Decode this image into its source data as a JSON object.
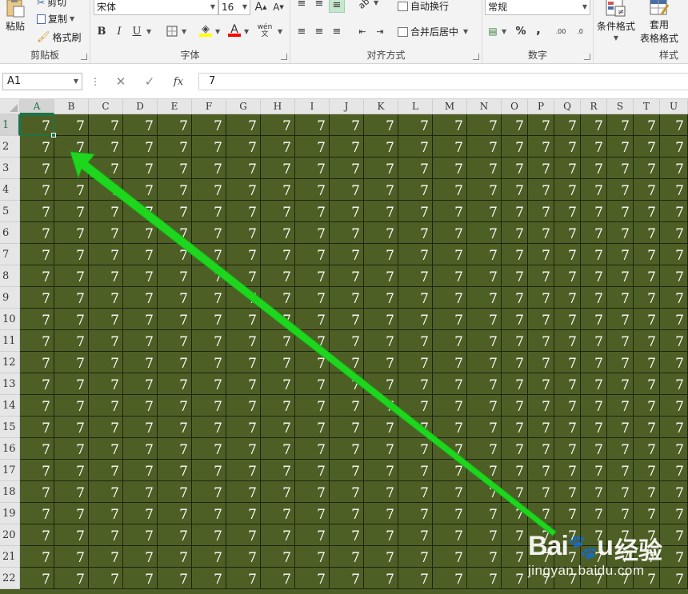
{
  "ribbon": {
    "clipboard": {
      "label": "剪贴板",
      "paste": "粘贴",
      "cut": "剪切",
      "copy": "复制",
      "format_painter": "格式刷"
    },
    "font": {
      "label": "字体",
      "font_name": "宋体",
      "font_size": "16",
      "grow_label": "A",
      "shrink_label": "A",
      "bold": "B",
      "italic": "I",
      "underline": "U",
      "font_color_letter": "A",
      "phonetic": "wén"
    },
    "alignment": {
      "label": "对齐方式",
      "wrap_text": "自动换行",
      "merge_center": "合并后居中"
    },
    "number": {
      "label": "数字",
      "format": "常规",
      "percent": "%",
      "comma": ",",
      "inc_decimal": ".00",
      "dec_decimal": ".0"
    },
    "styles": {
      "label": "样式",
      "conditional_format": "条件格式",
      "table_format_line1": "套用",
      "table_format_line2": "表格格式"
    },
    "accent_color": "#217346"
  },
  "formula_bar": {
    "name_box": "A1",
    "fx_symbol": "fx",
    "content": "7"
  },
  "sheet": {
    "columns": [
      "A",
      "B",
      "C",
      "D",
      "E",
      "F",
      "G",
      "H",
      "I",
      "J",
      "K",
      "L",
      "M",
      "N",
      "O",
      "P",
      "Q",
      "R",
      "S",
      "T",
      "U"
    ],
    "rows": [
      "1",
      "2",
      "3",
      "4",
      "5",
      "6",
      "7",
      "8",
      "9",
      "10",
      "11",
      "12",
      "13",
      "14",
      "15",
      "16",
      "17",
      "18",
      "19",
      "20",
      "21",
      "22"
    ],
    "cell_value": "7",
    "active_cell": "A1",
    "cell_fill_color": "#4e5f25",
    "arrow_color": "#1fd61f"
  },
  "watermark": {
    "brand_left": "Bai",
    "brand_right": "u",
    "brand_cn": "经验",
    "url": "jingyan.baidu.com"
  }
}
